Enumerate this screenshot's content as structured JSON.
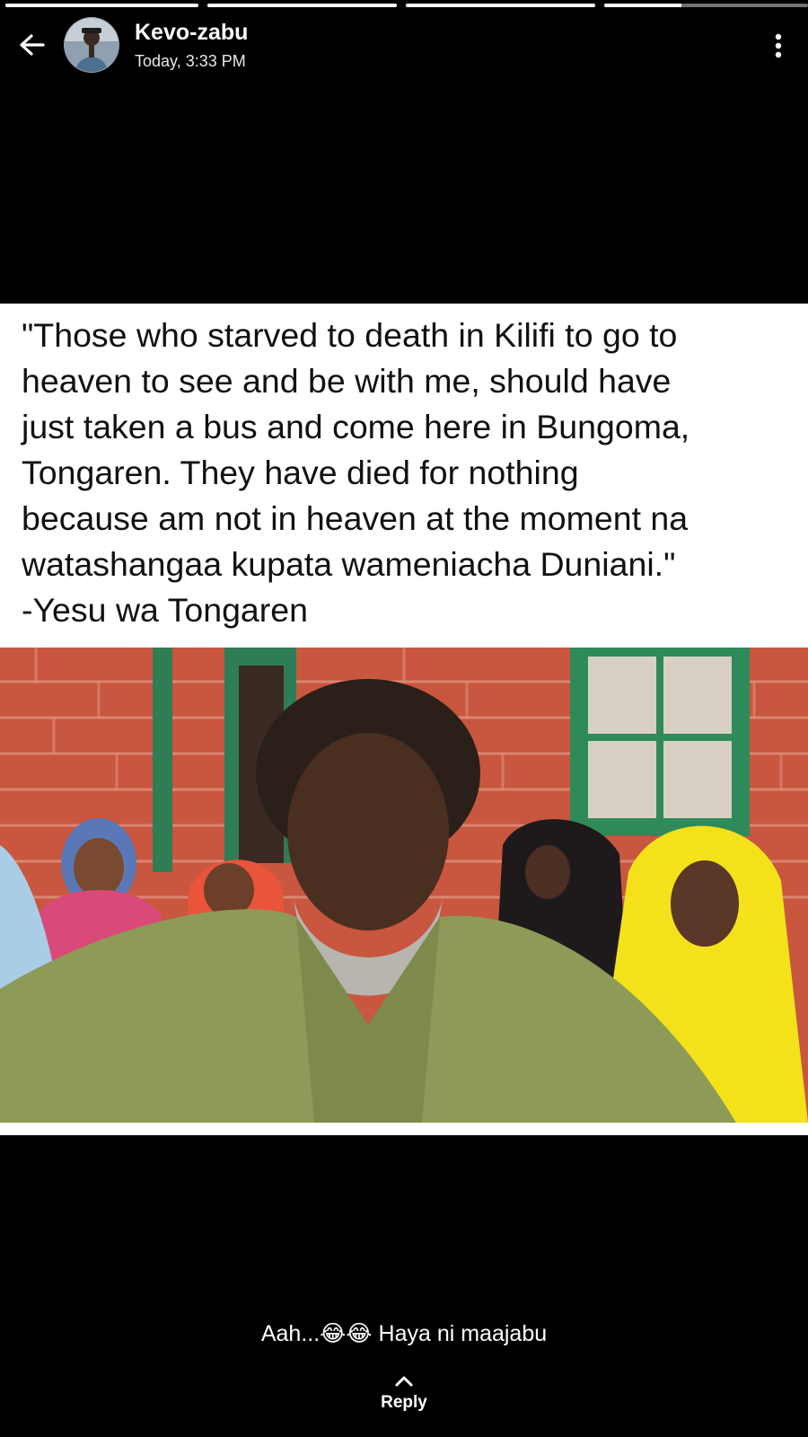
{
  "story": {
    "author": "Kevo-zabu",
    "timestamp": "Today, 3:33 PM",
    "segments_total": 4,
    "current_segment": 4,
    "current_segment_progress": 0.38
  },
  "post": {
    "quote_text": "\"Those who starved to death in Kilifi to go to\nheaven to see and be with me, should have\njust taken a bus and come here in Bungoma,\nTongaren. They have died for nothing\nbecause am not in heaven at the moment na\nwatashangaa kupata wameniacha Duniani.\"\n-Yesu wa Tongaren"
  },
  "caption": {
    "text": "Aah...😂😂 Haya ni maajabu"
  },
  "reply": {
    "label": "Reply"
  },
  "icons": {
    "back": "arrow-left-icon",
    "menu": "more-vertical-icon",
    "reply": "chevron-up-icon"
  }
}
